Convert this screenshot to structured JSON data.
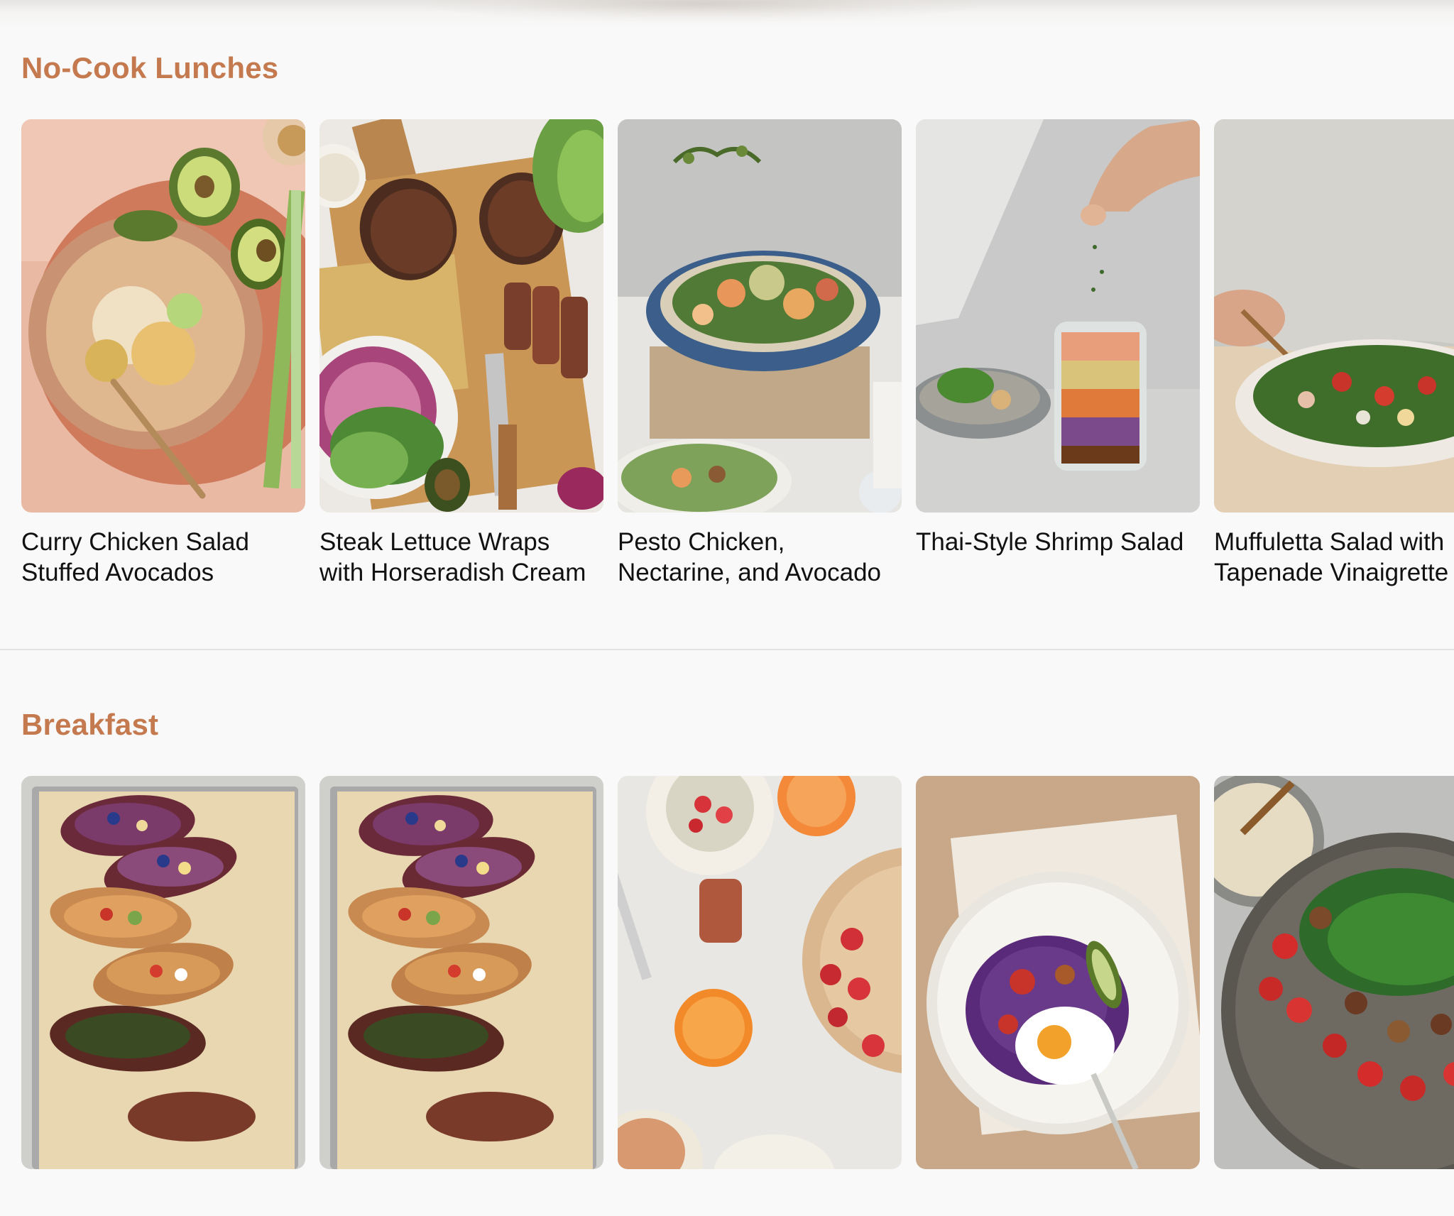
{
  "sections": [
    {
      "title": "No-Cook Lunches",
      "recipes": [
        {
          "title": "Curry Chicken Salad\nStuffed Avocados"
        },
        {
          "title": "Steak Lettuce Wraps\nwith Horseradish Cream"
        },
        {
          "title": "Pesto Chicken,\nNectarine, and Avocado"
        },
        {
          "title": "Thai-Style Shrimp Salad"
        },
        {
          "title": "Muffuletta Salad with\nTapenade Vinaigrette"
        }
      ]
    },
    {
      "title": "Breakfast",
      "recipes": [
        {
          "title": ""
        },
        {
          "title": ""
        },
        {
          "title": ""
        },
        {
          "title": ""
        },
        {
          "title": ""
        }
      ]
    }
  ],
  "colors": {
    "accent": "#c47a4e",
    "background": "#f9f9f9",
    "text": "#111111"
  }
}
